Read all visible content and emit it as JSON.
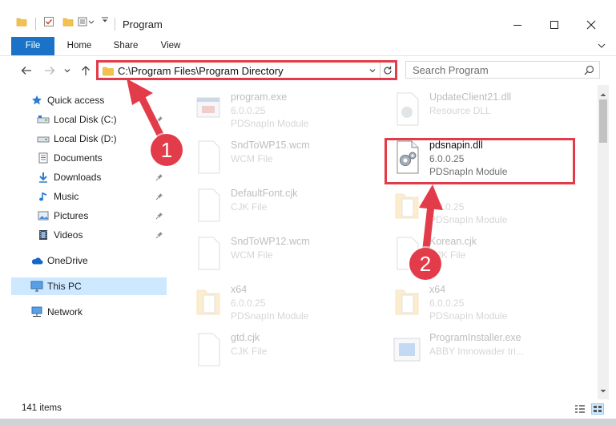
{
  "window": {
    "title": "Program",
    "controls": {
      "minimize": "—",
      "maximize": "☐",
      "close": "✕"
    }
  },
  "ribbon": {
    "tabs": [
      {
        "label": "File"
      },
      {
        "label": "Home"
      },
      {
        "label": "Share"
      },
      {
        "label": "View"
      }
    ]
  },
  "address": {
    "path": "C:\\Program Files\\Program Directory"
  },
  "search": {
    "placeholder": "Search Program"
  },
  "sidebar": {
    "items": [
      {
        "label": "Quick access",
        "icon": "star-icon",
        "pinned": false
      },
      {
        "label": "Local Disk (C:)",
        "icon": "drive-icon",
        "pinned": true
      },
      {
        "label": "Local Disk (D:)",
        "icon": "drive-icon",
        "pinned": false
      },
      {
        "label": "Documents",
        "icon": "documents-icon",
        "pinned": true
      },
      {
        "label": "Downloads",
        "icon": "download-arrow-icon",
        "pinned": true
      },
      {
        "label": "Music",
        "icon": "music-note-icon",
        "pinned": true
      },
      {
        "label": "Pictures",
        "icon": "pictures-icon",
        "pinned": true
      },
      {
        "label": "Videos",
        "icon": "film-icon",
        "pinned": true
      },
      {
        "label": "OneDrive",
        "icon": "cloud-icon",
        "pinned": false
      },
      {
        "label": "This PC",
        "icon": "monitor-icon",
        "pinned": false,
        "selected": true
      },
      {
        "label": "Network",
        "icon": "network-icon",
        "pinned": false
      }
    ]
  },
  "files": [
    {
      "name": "program.exe",
      "line1": "6.0.0.25",
      "line2": "PDSnapIn Module",
      "icon": "exe-icon",
      "faded": true
    },
    {
      "name": "UpdateClient21.dll",
      "line1": "Resource DLL",
      "line2": "",
      "icon": "dll-icon",
      "faded": true
    },
    {
      "name": "SndToWP15.wcm",
      "line1": "WCM File",
      "line2": "",
      "icon": "blank-file-icon",
      "faded": true
    },
    {
      "name": "pdsnapin.dll",
      "line1": "6.0.0.25",
      "line2": "PDSnapIn Module",
      "icon": "dll-gear-icon",
      "faded": false
    },
    {
      "name": "DefaultFont.cjk",
      "line1": "CJK File",
      "line2": "",
      "icon": "blank-file-icon",
      "faded": true
    },
    {
      "name": "",
      "line1": "6.0.0.25",
      "line2": "PDSnapIn Module",
      "icon": "folder-file-icon",
      "faded": true
    },
    {
      "name": "SndToWP12.wcm",
      "line1": "WCM File",
      "line2": "",
      "icon": "blank-file-icon",
      "faded": true
    },
    {
      "name": "Korean.cjk",
      "line1": "CJK File",
      "line2": "",
      "icon": "blank-file-icon",
      "faded": true
    },
    {
      "name": "x64",
      "line1": "6.0.0.25",
      "line2": "PDSnapIn Module",
      "icon": "folder-file-icon",
      "faded": true
    },
    {
      "name": "x64",
      "line1": "6.0.0.25",
      "line2": "PDSnapIn Module",
      "icon": "folder-file-icon",
      "faded": true
    },
    {
      "name": "gtd.cjk",
      "line1": "CJK File",
      "line2": "",
      "icon": "blank-file-icon",
      "faded": true
    },
    {
      "name": "ProgramInstaller.exe",
      "line1": "ABBY Imnowader tri...",
      "line2": "",
      "icon": "installer-icon",
      "faded": true
    }
  ],
  "status": {
    "count": "141 items"
  },
  "annotations": {
    "step1": "1",
    "step2": "2",
    "color": "#e23c4a"
  }
}
